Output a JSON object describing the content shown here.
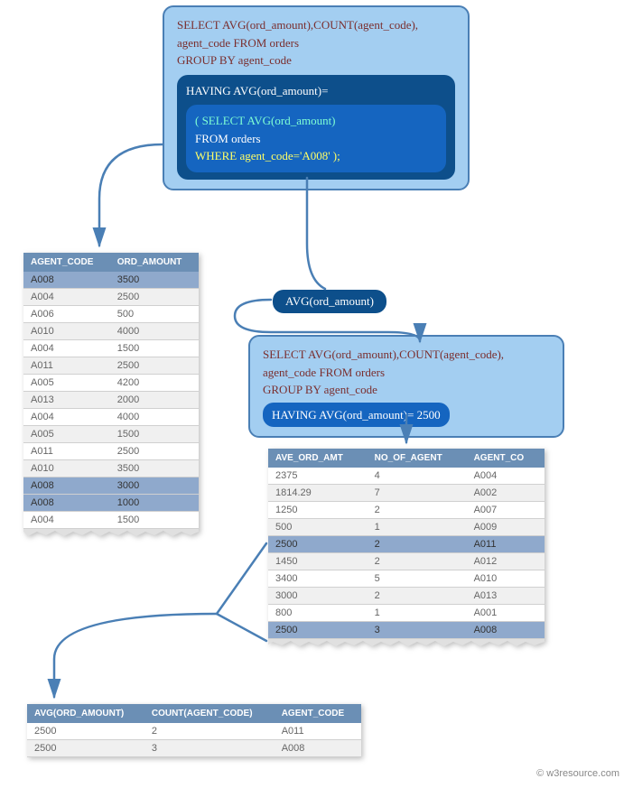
{
  "query1": {
    "line1_a": "SELECT AVG(ord_amount),COUNT(agent_code),",
    "line1_b": "agent_code FROM orders",
    "line1_c": "GROUP BY agent_code",
    "having": "HAVING AVG(ord_amount)=",
    "sub1": "( SELECT AVG(ord_amount)",
    "sub2": "FROM orders",
    "sub3": "WHERE agent_code='A008' );"
  },
  "pill": "AVG(ord_amount)",
  "query2": {
    "line1": "SELECT AVG(ord_amount),COUNT(agent_code),",
    "line2": "agent_code FROM orders",
    "line3": "GROUP BY agent_code",
    "having": " HAVING AVG(ord_amount)= 2500 "
  },
  "table1": {
    "headers": [
      "AGENT_CODE",
      "ORD_AMOUNT"
    ],
    "rows": [
      {
        "c": [
          "A008",
          "3500"
        ],
        "hl": true
      },
      {
        "c": [
          "A004",
          "2500"
        ]
      },
      {
        "c": [
          "A006",
          "500"
        ]
      },
      {
        "c": [
          "A010",
          "4000"
        ]
      },
      {
        "c": [
          "A004",
          "1500"
        ]
      },
      {
        "c": [
          "A011",
          "2500"
        ]
      },
      {
        "c": [
          "A005",
          "4200"
        ]
      },
      {
        "c": [
          "A013",
          "2000"
        ]
      },
      {
        "c": [
          "A004",
          "4000"
        ]
      },
      {
        "c": [
          "A005",
          "1500"
        ]
      },
      {
        "c": [
          "A011",
          "2500"
        ]
      },
      {
        "c": [
          "A010",
          "3500"
        ]
      },
      {
        "c": [
          "A008",
          "3000"
        ],
        "hl": true
      },
      {
        "c": [
          "A008",
          "1000"
        ],
        "hl": true
      },
      {
        "c": [
          "A004",
          "1500"
        ]
      }
    ]
  },
  "table2": {
    "headers": [
      "AVE_ORD_AMT",
      "NO_OF_AGENT",
      "AGENT_CO"
    ],
    "rows": [
      {
        "c": [
          "2375",
          "4",
          "A004"
        ]
      },
      {
        "c": [
          "1814.29",
          "7",
          "A002"
        ]
      },
      {
        "c": [
          "1250",
          "2",
          "A007"
        ]
      },
      {
        "c": [
          "500",
          "1",
          "A009"
        ]
      },
      {
        "c": [
          "2500",
          "2",
          "A011"
        ],
        "hl": true
      },
      {
        "c": [
          "1450",
          "2",
          "A012"
        ]
      },
      {
        "c": [
          "3400",
          "5",
          "A010"
        ]
      },
      {
        "c": [
          "3000",
          "2",
          "A013"
        ]
      },
      {
        "c": [
          "800",
          "1",
          "A001"
        ]
      },
      {
        "c": [
          "2500",
          "3",
          "A008"
        ],
        "hl": true
      }
    ]
  },
  "table3": {
    "headers": [
      "AVG(ORD_AMOUNT)",
      "COUNT(AGENT_CODE)",
      "AGENT_CODE"
    ],
    "rows": [
      {
        "c": [
          "2500",
          "2",
          "A011"
        ]
      },
      {
        "c": [
          "2500",
          "3",
          "A008"
        ]
      }
    ]
  },
  "copyright": "© w3resource.com"
}
